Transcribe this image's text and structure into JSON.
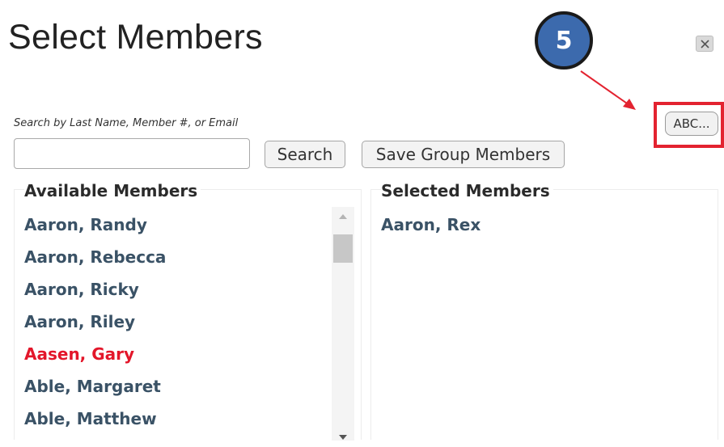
{
  "dialog": {
    "title": "Select Members",
    "step_badge": "5",
    "close_icon": "close-icon"
  },
  "alpha_button": {
    "label": "ABC..."
  },
  "search": {
    "label": "Search by Last Name, Member #, or Email",
    "value": "",
    "placeholder": "",
    "search_label": "Search",
    "save_label": "Save Group Members"
  },
  "available": {
    "header": "Available Members",
    "items": [
      {
        "name": "Aaron, Randy"
      },
      {
        "name": "Aaron, Rebecca"
      },
      {
        "name": "Aaron, Ricky"
      },
      {
        "name": "Aaron, Riley"
      },
      {
        "name": "Aasen, Gary",
        "color": "#e3162a"
      },
      {
        "name": "Able, Margaret"
      },
      {
        "name": "Able, Matthew"
      }
    ]
  },
  "selected": {
    "header": "Selected Members",
    "items": [
      {
        "name": "Aaron, Rex"
      }
    ]
  },
  "colors": {
    "member_text": "#3a5266",
    "highlight_red": "#e3162a",
    "badge_blue": "#3c6aad"
  }
}
